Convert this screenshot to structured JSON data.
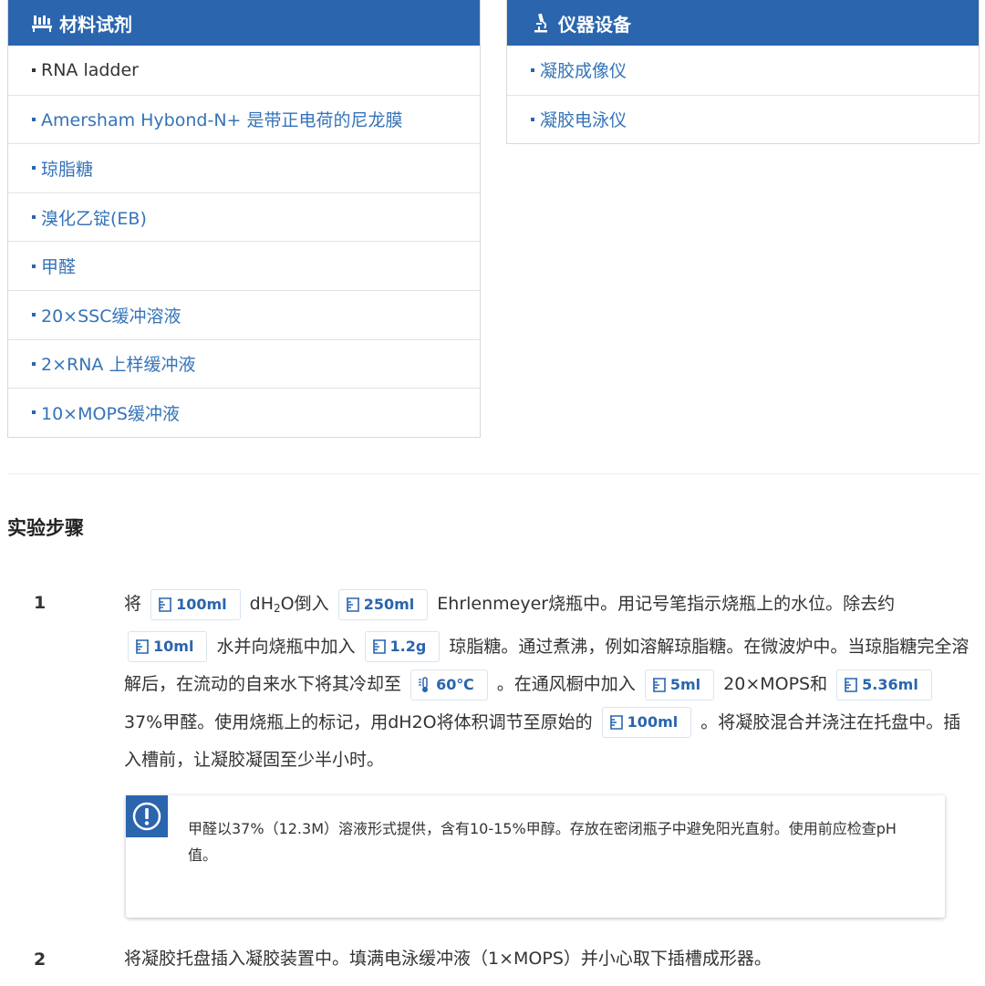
{
  "materials": {
    "title": "材料试剂",
    "items": [
      {
        "label": "RNA ladder"
      },
      {
        "label": "Amersham Hybond-N+ 是带正电荷的尼龙膜"
      },
      {
        "label": "琼脂糖"
      },
      {
        "label": "溴化乙锭(EB)"
      },
      {
        "label": "甲醛"
      },
      {
        "label": "20×SSC缓冲溶液"
      },
      {
        "label": "2×RNA 上样缓冲液"
      },
      {
        "label": "10×MOPS缓冲液"
      }
    ]
  },
  "equipment": {
    "title": "仪器设备",
    "items": [
      {
        "label": "凝胶成像仪"
      },
      {
        "label": "凝胶电泳仪"
      }
    ]
  },
  "steps": {
    "title": "实验步骤",
    "step1": {
      "number": "1",
      "t0": "将",
      "c1": "100ml",
      "t1a": "dH",
      "t1sub": "2",
      "t1b": "O倒入",
      "c2": "250ml",
      "t2": "Ehrlenmeyer烧瓶中。用记号笔指示烧瓶上的水位。除去约",
      "c3": "10ml",
      "t3": "水并向烧瓶中加入",
      "c4": "1.2g",
      "t4": "琼脂糖。通过煮沸，例如溶解琼脂糖。在微波炉中。当琼脂糖完全溶解后，在流动的自来水下将其冷却至",
      "c5": "60℃",
      "t5": "。在通风橱中加入",
      "c6": "5ml",
      "t6": "20×MOPS和",
      "c7": "5.36ml",
      "t7": "37%甲醛。使用烧瓶上的标记，用dH2O将体积调节至原始的",
      "c8": "100ml",
      "t8": "。将凝胶混合并浇注在托盘中。插入槽前，让凝胶凝固至少半小时。"
    },
    "note": "甲醛以37%（12.3M）溶液形式提供，含有10-15%甲醇。存放在密闭瓶子中避免阳光直射。使用前应检查pH值。",
    "step2": {
      "number": "2",
      "text": "将凝胶托盘插入凝胶装置中。填满电泳缓冲液（1×MOPS）并小心取下插槽成形器。"
    }
  },
  "icons": {
    "materials": "flask-rack-icon",
    "equipment": "microscope-icon",
    "volume": "beaker-icon",
    "temperature": "thermometer-icon",
    "note": "alert-icon"
  },
  "colors": {
    "header_bg": "#2a65ae",
    "link": "#3473b8",
    "chip_text": "#2a65ae"
  }
}
